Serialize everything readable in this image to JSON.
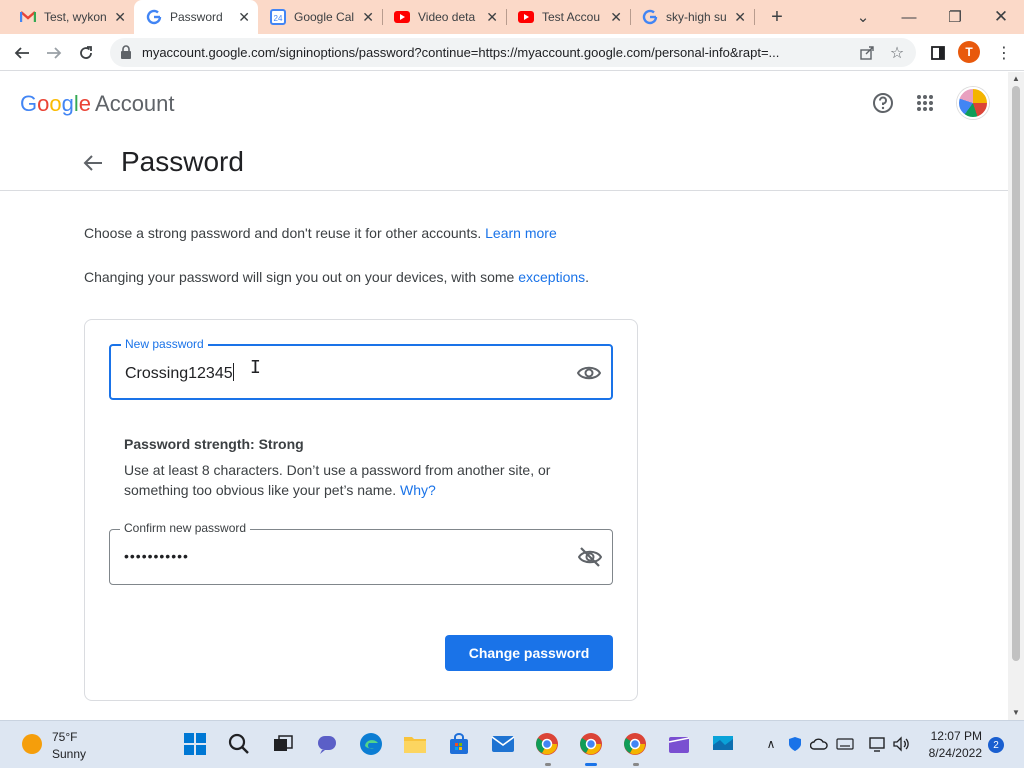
{
  "browser": {
    "tabs": [
      {
        "title": "Test, wykon",
        "icon": "gmail-icon",
        "active": false
      },
      {
        "title": "Password",
        "icon": "google-icon",
        "active": true
      },
      {
        "title": "Google Cal",
        "icon": "google-calendar-icon",
        "active": false
      },
      {
        "title": "Video deta",
        "icon": "youtube-icon",
        "active": false
      },
      {
        "title": "Test Accou",
        "icon": "youtube-icon",
        "active": false
      },
      {
        "title": "sky-high su",
        "icon": "google-icon",
        "active": false
      }
    ],
    "url": "myaccount.google.com/signinoptions/password?continue=https://myaccount.google.com/personal-info&rapt=...",
    "profile_initial": "T"
  },
  "header": {
    "logo_word": "Google",
    "logo_suffix": "Account"
  },
  "page": {
    "title": "Password",
    "intro": {
      "text": "Choose a strong password and don't reuse it for other accounts.",
      "link": "Learn more"
    },
    "signout": {
      "text": "Changing your password will sign you out on your devices, with some",
      "link": "exceptions",
      "suffix": "."
    },
    "new_password": {
      "label": "New password",
      "value": "Crossing12345"
    },
    "strength": "Password strength: Strong",
    "hint": {
      "text": "Use at least 8 characters. Don’t use a password from another site, or something too obvious like your pet’s name.",
      "link": "Why?"
    },
    "confirm_password": {
      "label": "Confirm new password",
      "value": "•••••••••••"
    },
    "submit_label": "Change password"
  },
  "taskbar": {
    "weather_temp": "75°F",
    "weather_cond": "Sunny",
    "time": "12:07 PM",
    "date": "8/24/2022",
    "notifications": "2"
  },
  "colors": {
    "accent": "#1a73e8",
    "tabstrip": "#fbd9c8",
    "google_blue": "#4285f4",
    "google_red": "#ea4335",
    "google_yellow": "#fbbc05",
    "google_green": "#34a853"
  }
}
